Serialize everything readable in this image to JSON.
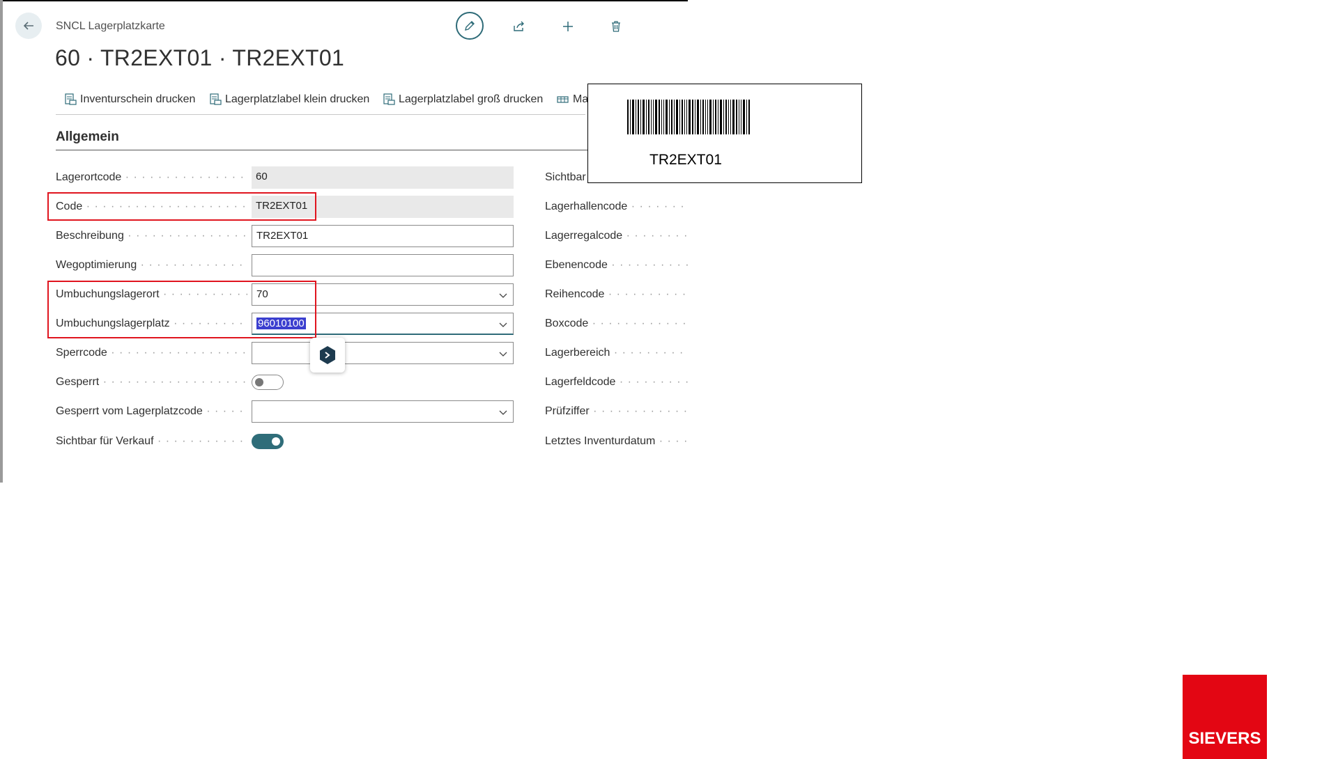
{
  "header": {
    "caption": "SNCL Lagerplatzkarte",
    "title": "60 · TR2EXT01 · TR2EXT01",
    "icons": [
      "back-arrow-icon",
      "pencil-icon",
      "share-icon",
      "plus-icon",
      "trash-icon"
    ]
  },
  "actions": [
    {
      "label": "Inventurschein drucken",
      "icon": "print-report-icon"
    },
    {
      "label": "Lagerplatzlabel klein drucken",
      "icon": "print-report-icon"
    },
    {
      "label": "Lagerplatzlabel groß drucken",
      "icon": "print-report-icon"
    },
    {
      "label": "Ma",
      "icon": "table-icon"
    }
  ],
  "section": {
    "title": "Allgemein"
  },
  "left_fields": [
    {
      "label": "Lagerortcode",
      "value": "60",
      "kind": "readonly"
    },
    {
      "label": "Code",
      "value": "TR2EXT01",
      "kind": "readonly"
    },
    {
      "label": "Beschreibung",
      "value": "TR2EXT01",
      "kind": "text"
    },
    {
      "label": "Wegoptimierung",
      "value": "",
      "kind": "text"
    },
    {
      "label": "Umbuchungslagerort",
      "value": "70",
      "kind": "dropdown"
    },
    {
      "label": "Umbuchungslagerplatz",
      "value": "96010100",
      "kind": "dropdown",
      "focused": true,
      "selected": true
    },
    {
      "label": "Sperrcode",
      "value": "",
      "kind": "dropdown"
    },
    {
      "label": "Gesperrt",
      "kind": "toggle",
      "checked": false
    },
    {
      "label": "Gesperrt vom Lagerplatzcode",
      "value": "",
      "kind": "dropdown"
    },
    {
      "label": "Sichtbar für Verkauf",
      "kind": "toggle",
      "checked": true
    }
  ],
  "right_fields": [
    {
      "label": "Sichtbar"
    },
    {
      "label": "Lagerhallencode"
    },
    {
      "label": "Lagerregalcode"
    },
    {
      "label": "Ebenencode"
    },
    {
      "label": "Reihencode"
    },
    {
      "label": "Boxcode"
    },
    {
      "label": "Lagerbereich"
    },
    {
      "label": "Lagerfeldcode"
    },
    {
      "label": "Prüfziffer"
    },
    {
      "label": "Letztes Inventurdatum"
    }
  ],
  "barcode": {
    "text": "TR2EXT01"
  },
  "colors": {
    "accent": "#2e6b78",
    "highlight_box": "#e0141e",
    "selection": "#3b3fcf",
    "logo_bg": "#e30613"
  },
  "logo": {
    "text": "SIEVERS"
  }
}
